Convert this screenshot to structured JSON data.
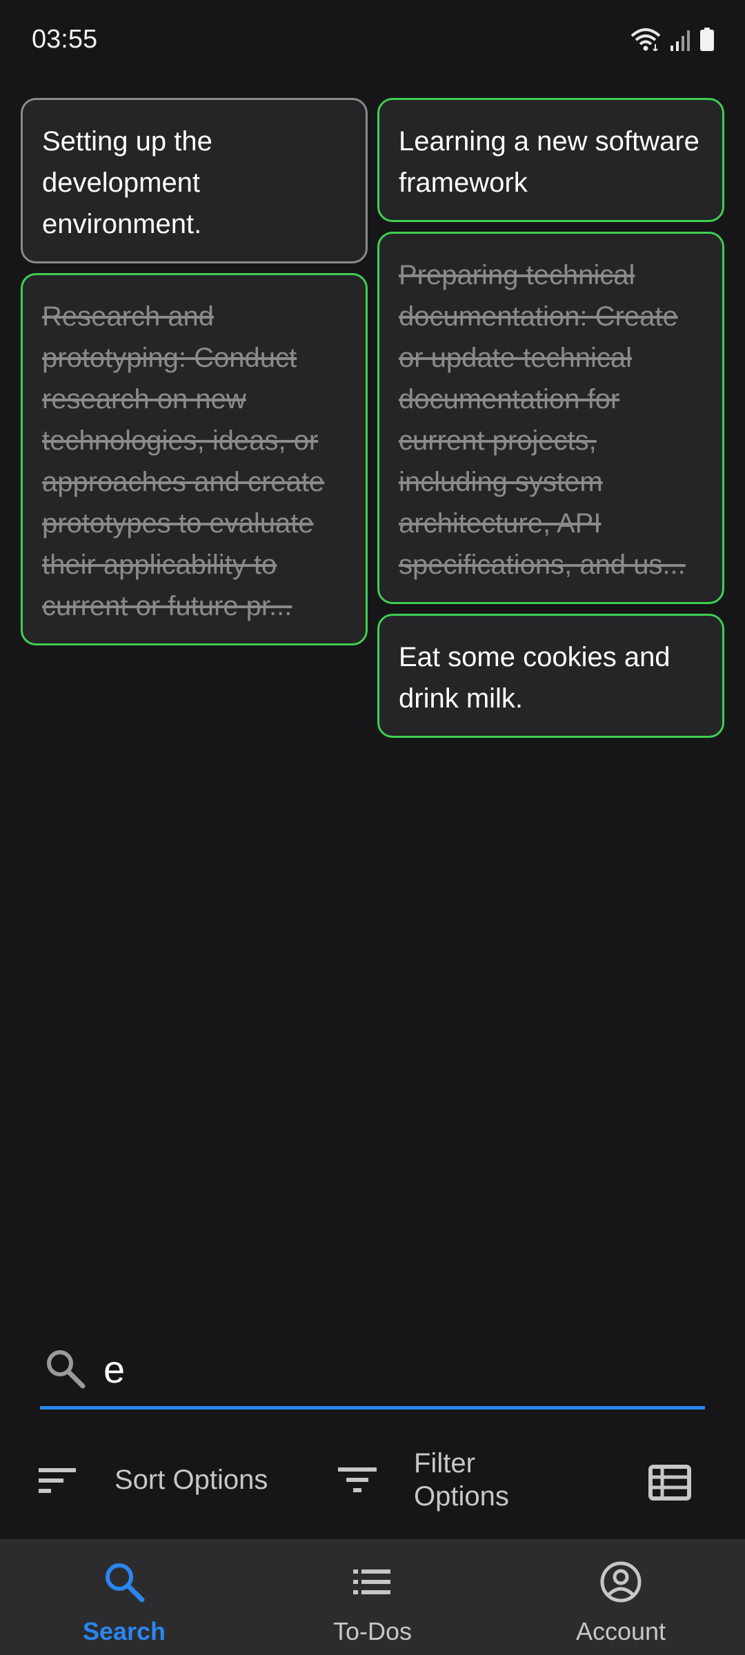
{
  "status_bar": {
    "time": "03:55",
    "icons": [
      "wifi-icon",
      "signal-icon",
      "battery-icon"
    ]
  },
  "cards": {
    "left": [
      {
        "text": "Setting up the development environment.",
        "completed": false
      },
      {
        "text": "Research and prototyping: Conduct research on new technologies, ideas, or approaches and create prototypes to evaluate their applicability to current or future pr...",
        "completed": true
      }
    ],
    "right": [
      {
        "text": "Learning a new software framework",
        "completed": false
      },
      {
        "text": "Preparing technical documentation: Create or update technical documentation for current projects, including system architecture, API specifications, and us...",
        "completed": true
      },
      {
        "text": "Eat some cookies and drink milk.",
        "completed": false
      }
    ]
  },
  "search": {
    "value": "e",
    "icon": "search-icon"
  },
  "options": {
    "sort_label": "Sort Options",
    "filter_label": "Filter Options",
    "view_icon": "table-view-icon"
  },
  "bottom_nav": {
    "items": [
      {
        "label": "Search",
        "icon": "search-icon",
        "active": true
      },
      {
        "label": "To-Dos",
        "icon": "list-icon",
        "active": false
      },
      {
        "label": "Account",
        "icon": "account-icon",
        "active": false
      }
    ]
  },
  "colors": {
    "accent": "#2a86f0",
    "card_border_green": "#3ecf52",
    "card_border_gray": "#8a8a8c",
    "background": "#161618",
    "card_background": "#252527"
  }
}
